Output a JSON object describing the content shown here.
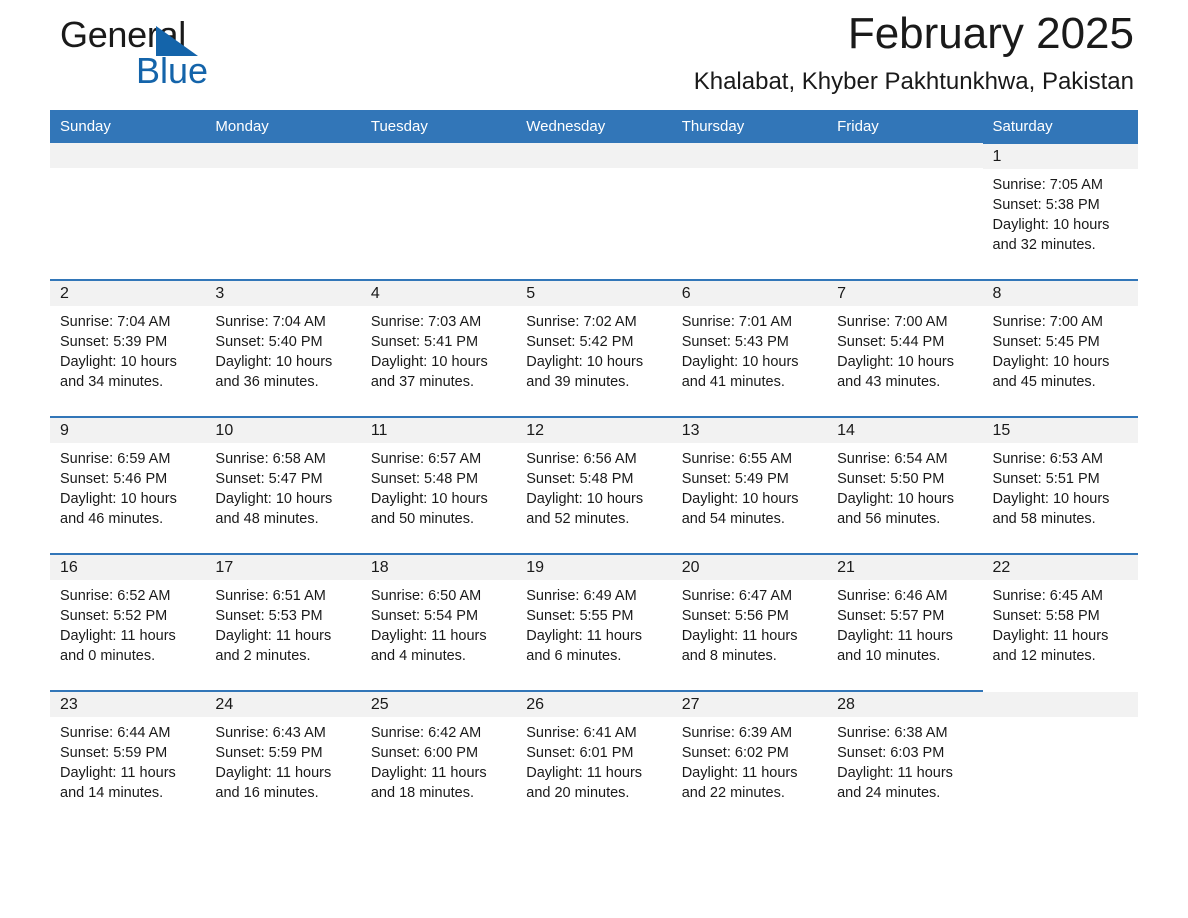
{
  "brand": {
    "name_part1": "General",
    "name_part2": "Blue"
  },
  "header": {
    "month_title": "February 2025",
    "location": "Khalabat, Khyber Pakhtunkhwa, Pakistan"
  },
  "colors": {
    "header_blue": "#3276b8",
    "logo_blue": "#1464aa",
    "daynum_band": "#f2f2f2",
    "text": "#1a1a1a"
  },
  "weekday_headers": [
    "Sunday",
    "Monday",
    "Tuesday",
    "Wednesday",
    "Thursday",
    "Friday",
    "Saturday"
  ],
  "weeks": [
    [
      {
        "day": "",
        "sunrise": "",
        "sunset": "",
        "daylight": "",
        "empty": true
      },
      {
        "day": "",
        "sunrise": "",
        "sunset": "",
        "daylight": "",
        "empty": true
      },
      {
        "day": "",
        "sunrise": "",
        "sunset": "",
        "daylight": "",
        "empty": true
      },
      {
        "day": "",
        "sunrise": "",
        "sunset": "",
        "daylight": "",
        "empty": true
      },
      {
        "day": "",
        "sunrise": "",
        "sunset": "",
        "daylight": "",
        "empty": true
      },
      {
        "day": "",
        "sunrise": "",
        "sunset": "",
        "daylight": "",
        "empty": true
      },
      {
        "day": "1",
        "sunrise": "Sunrise: 7:05 AM",
        "sunset": "Sunset: 5:38 PM",
        "daylight": "Daylight: 10 hours and 32 minutes.",
        "empty": false
      }
    ],
    [
      {
        "day": "2",
        "sunrise": "Sunrise: 7:04 AM",
        "sunset": "Sunset: 5:39 PM",
        "daylight": "Daylight: 10 hours and 34 minutes.",
        "empty": false
      },
      {
        "day": "3",
        "sunrise": "Sunrise: 7:04 AM",
        "sunset": "Sunset: 5:40 PM",
        "daylight": "Daylight: 10 hours and 36 minutes.",
        "empty": false
      },
      {
        "day": "4",
        "sunrise": "Sunrise: 7:03 AM",
        "sunset": "Sunset: 5:41 PM",
        "daylight": "Daylight: 10 hours and 37 minutes.",
        "empty": false
      },
      {
        "day": "5",
        "sunrise": "Sunrise: 7:02 AM",
        "sunset": "Sunset: 5:42 PM",
        "daylight": "Daylight: 10 hours and 39 minutes.",
        "empty": false
      },
      {
        "day": "6",
        "sunrise": "Sunrise: 7:01 AM",
        "sunset": "Sunset: 5:43 PM",
        "daylight": "Daylight: 10 hours and 41 minutes.",
        "empty": false
      },
      {
        "day": "7",
        "sunrise": "Sunrise: 7:00 AM",
        "sunset": "Sunset: 5:44 PM",
        "daylight": "Daylight: 10 hours and 43 minutes.",
        "empty": false
      },
      {
        "day": "8",
        "sunrise": "Sunrise: 7:00 AM",
        "sunset": "Sunset: 5:45 PM",
        "daylight": "Daylight: 10 hours and 45 minutes.",
        "empty": false
      }
    ],
    [
      {
        "day": "9",
        "sunrise": "Sunrise: 6:59 AM",
        "sunset": "Sunset: 5:46 PM",
        "daylight": "Daylight: 10 hours and 46 minutes.",
        "empty": false
      },
      {
        "day": "10",
        "sunrise": "Sunrise: 6:58 AM",
        "sunset": "Sunset: 5:47 PM",
        "daylight": "Daylight: 10 hours and 48 minutes.",
        "empty": false
      },
      {
        "day": "11",
        "sunrise": "Sunrise: 6:57 AM",
        "sunset": "Sunset: 5:48 PM",
        "daylight": "Daylight: 10 hours and 50 minutes.",
        "empty": false
      },
      {
        "day": "12",
        "sunrise": "Sunrise: 6:56 AM",
        "sunset": "Sunset: 5:48 PM",
        "daylight": "Daylight: 10 hours and 52 minutes.",
        "empty": false
      },
      {
        "day": "13",
        "sunrise": "Sunrise: 6:55 AM",
        "sunset": "Sunset: 5:49 PM",
        "daylight": "Daylight: 10 hours and 54 minutes.",
        "empty": false
      },
      {
        "day": "14",
        "sunrise": "Sunrise: 6:54 AM",
        "sunset": "Sunset: 5:50 PM",
        "daylight": "Daylight: 10 hours and 56 minutes.",
        "empty": false
      },
      {
        "day": "15",
        "sunrise": "Sunrise: 6:53 AM",
        "sunset": "Sunset: 5:51 PM",
        "daylight": "Daylight: 10 hours and 58 minutes.",
        "empty": false
      }
    ],
    [
      {
        "day": "16",
        "sunrise": "Sunrise: 6:52 AM",
        "sunset": "Sunset: 5:52 PM",
        "daylight": "Daylight: 11 hours and 0 minutes.",
        "empty": false
      },
      {
        "day": "17",
        "sunrise": "Sunrise: 6:51 AM",
        "sunset": "Sunset: 5:53 PM",
        "daylight": "Daylight: 11 hours and 2 minutes.",
        "empty": false
      },
      {
        "day": "18",
        "sunrise": "Sunrise: 6:50 AM",
        "sunset": "Sunset: 5:54 PM",
        "daylight": "Daylight: 11 hours and 4 minutes.",
        "empty": false
      },
      {
        "day": "19",
        "sunrise": "Sunrise: 6:49 AM",
        "sunset": "Sunset: 5:55 PM",
        "daylight": "Daylight: 11 hours and 6 minutes.",
        "empty": false
      },
      {
        "day": "20",
        "sunrise": "Sunrise: 6:47 AM",
        "sunset": "Sunset: 5:56 PM",
        "daylight": "Daylight: 11 hours and 8 minutes.",
        "empty": false
      },
      {
        "day": "21",
        "sunrise": "Sunrise: 6:46 AM",
        "sunset": "Sunset: 5:57 PM",
        "daylight": "Daylight: 11 hours and 10 minutes.",
        "empty": false
      },
      {
        "day": "22",
        "sunrise": "Sunrise: 6:45 AM",
        "sunset": "Sunset: 5:58 PM",
        "daylight": "Daylight: 11 hours and 12 minutes.",
        "empty": false
      }
    ],
    [
      {
        "day": "23",
        "sunrise": "Sunrise: 6:44 AM",
        "sunset": "Sunset: 5:59 PM",
        "daylight": "Daylight: 11 hours and 14 minutes.",
        "empty": false
      },
      {
        "day": "24",
        "sunrise": "Sunrise: 6:43 AM",
        "sunset": "Sunset: 5:59 PM",
        "daylight": "Daylight: 11 hours and 16 minutes.",
        "empty": false
      },
      {
        "day": "25",
        "sunrise": "Sunrise: 6:42 AM",
        "sunset": "Sunset: 6:00 PM",
        "daylight": "Daylight: 11 hours and 18 minutes.",
        "empty": false
      },
      {
        "day": "26",
        "sunrise": "Sunrise: 6:41 AM",
        "sunset": "Sunset: 6:01 PM",
        "daylight": "Daylight: 11 hours and 20 minutes.",
        "empty": false
      },
      {
        "day": "27",
        "sunrise": "Sunrise: 6:39 AM",
        "sunset": "Sunset: 6:02 PM",
        "daylight": "Daylight: 11 hours and 22 minutes.",
        "empty": false
      },
      {
        "day": "28",
        "sunrise": "Sunrise: 6:38 AM",
        "sunset": "Sunset: 6:03 PM",
        "daylight": "Daylight: 11 hours and 24 minutes.",
        "empty": false
      },
      {
        "day": "",
        "sunrise": "",
        "sunset": "",
        "daylight": "",
        "empty": true
      }
    ]
  ]
}
